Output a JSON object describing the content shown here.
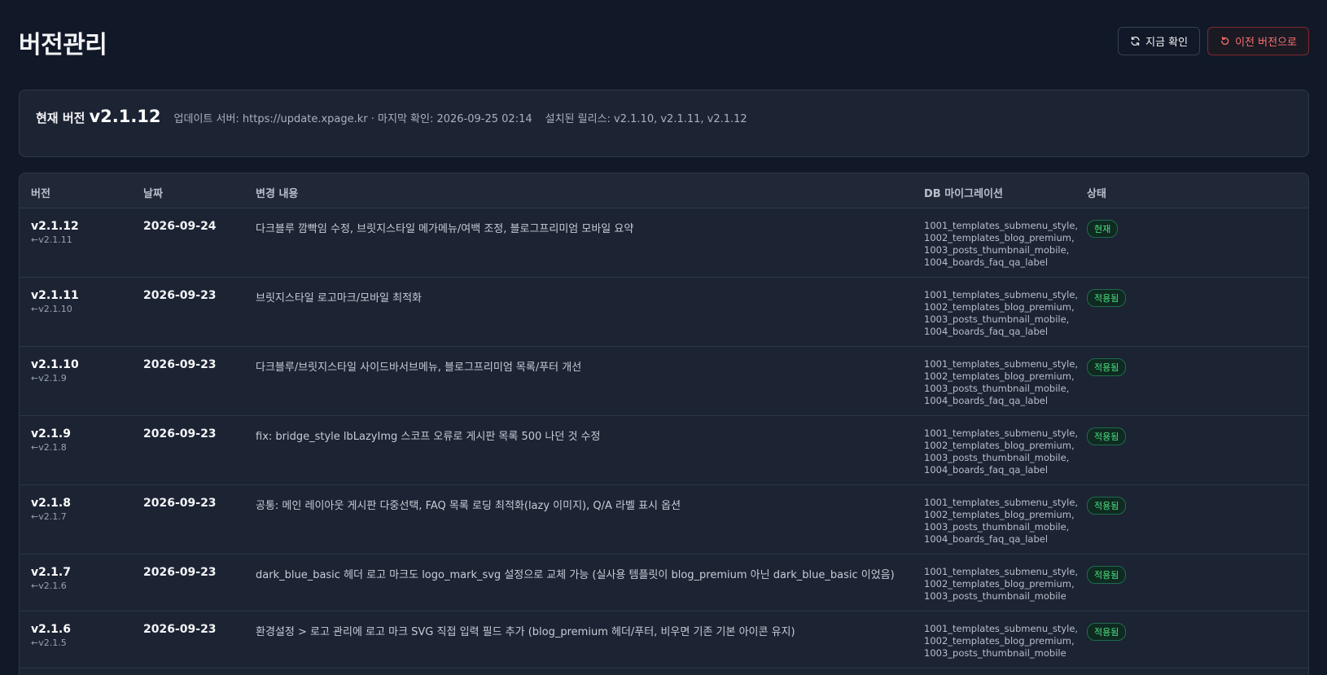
{
  "header": {
    "title": "버전관리",
    "check_now_label": "지금 확인",
    "rollback_label": "이전 버전으로"
  },
  "summary": {
    "current_label": "현재 버전",
    "current_version": "v2.1.12",
    "server_info": "업데이트 서버: https://update.xpage.kr · 마지막 확인: 2026-09-25 02:14",
    "installed_releases": "설치된 릴리스: v2.1.10, v2.1.11, v2.1.12"
  },
  "table": {
    "columns": {
      "version": "버전",
      "date": "날짜",
      "changes": "변경 내용",
      "db_migration": "DB 마이그레이션",
      "status": "상태"
    },
    "rows": [
      {
        "version": "v2.1.12",
        "prev": "←v2.1.11",
        "date": "2026-09-24",
        "changes": "다크블루 깜빡임 수정, 브릿지스타일 메가메뉴/여백 조정, 블로그프리미엄 모바일 요약",
        "db": [
          "1001_templates_submenu_style,",
          "1002_templates_blog_premium,",
          "1003_posts_thumbnail_mobile,",
          "1004_boards_faq_qa_label"
        ],
        "status": "현재"
      },
      {
        "version": "v2.1.11",
        "prev": "←v2.1.10",
        "date": "2026-09-23",
        "changes": "브릿지스타일 로고마크/모바일 최적화",
        "db": [
          "1001_templates_submenu_style,",
          "1002_templates_blog_premium,",
          "1003_posts_thumbnail_mobile,",
          "1004_boards_faq_qa_label"
        ],
        "status": "적용됨"
      },
      {
        "version": "v2.1.10",
        "prev": "←v2.1.9",
        "date": "2026-09-23",
        "changes": "다크블루/브릿지스타일 사이드바서브메뉴, 블로그프리미엄 목록/푸터 개선",
        "db": [
          "1001_templates_submenu_style,",
          "1002_templates_blog_premium,",
          "1003_posts_thumbnail_mobile,",
          "1004_boards_faq_qa_label"
        ],
        "status": "적용됨"
      },
      {
        "version": "v2.1.9",
        "prev": "←v2.1.8",
        "date": "2026-09-23",
        "changes": "fix: bridge_style lbLazyImg 스코프 오류로 게시판 목록 500 나던 것 수정",
        "db": [
          "1001_templates_submenu_style,",
          "1002_templates_blog_premium,",
          "1003_posts_thumbnail_mobile,",
          "1004_boards_faq_qa_label"
        ],
        "status": "적용됨"
      },
      {
        "version": "v2.1.8",
        "prev": "←v2.1.7",
        "date": "2026-09-23",
        "changes": "공통: 메인 레이아웃 게시판 다중선택, FAQ 목록 로딩 최적화(lazy 이미지), Q/A 라벨 표시 옵션",
        "db": [
          "1001_templates_submenu_style,",
          "1002_templates_blog_premium,",
          "1003_posts_thumbnail_mobile,",
          "1004_boards_faq_qa_label"
        ],
        "status": "적용됨"
      },
      {
        "version": "v2.1.7",
        "prev": "←v2.1.6",
        "date": "2026-09-23",
        "changes": "dark_blue_basic 헤더 로고 마크도 logo_mark_svg 설정으로 교체 가능 (실사용 템플릿이 blog_premium 아닌 dark_blue_basic 이었음)",
        "db": [
          "1001_templates_submenu_style,",
          "1002_templates_blog_premium,",
          "1003_posts_thumbnail_mobile"
        ],
        "status": "적용됨"
      },
      {
        "version": "v2.1.6",
        "prev": "←v2.1.5",
        "date": "2026-09-23",
        "changes": "환경설정 > 로고 관리에 로고 마크 SVG 직접 입력 필드 추가 (blog_premium 헤더/푸터, 비우면 기존 기본 아이콘 유지)",
        "db": [
          "1001_templates_submenu_style,",
          "1002_templates_blog_premium,",
          "1003_posts_thumbnail_mobile"
        ],
        "status": "적용됨"
      }
    ]
  }
}
